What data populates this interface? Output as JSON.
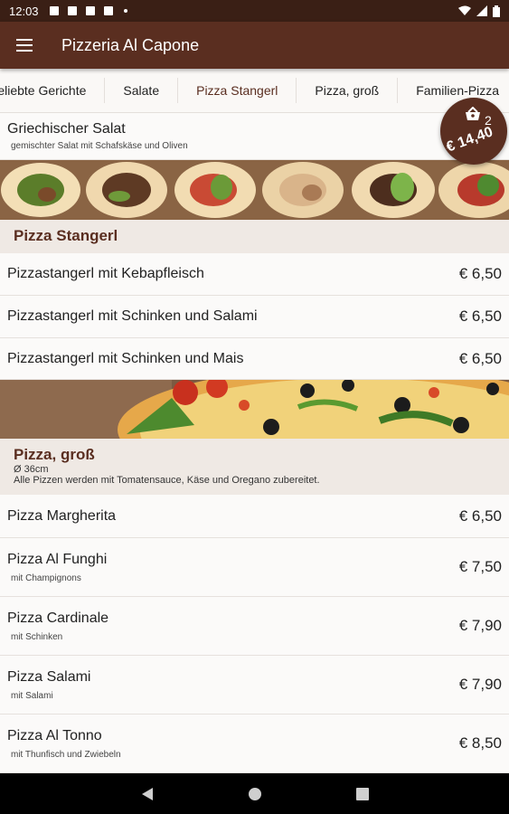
{
  "status": {
    "time": "12:03"
  },
  "appbar": {
    "title": "Pizzeria Al Capone"
  },
  "tabs": [
    "Beliebte Gerichte",
    "Salate",
    "Pizza Stangerl",
    "Pizza, groß",
    "Familien-Pizza"
  ],
  "cart": {
    "count": "2",
    "total": "€ 14,40"
  },
  "top_item": {
    "name": "Griechischer Salat",
    "desc": "gemischter Salat mit Schafskäse und Oliven"
  },
  "sections": [
    {
      "name": "Pizza Stangerl",
      "items": [
        {
          "name": "Pizzastangerl mit Kebapfleisch",
          "price": "€ 6,50"
        },
        {
          "name": "Pizzastangerl mit Schinken und Salami",
          "price": "€ 6,50"
        },
        {
          "name": "Pizzastangerl mit Schinken und Mais",
          "price": "€ 6,50"
        }
      ]
    },
    {
      "name": "Pizza, groß",
      "size": "Ø 36cm",
      "note": "Alle Pizzen werden mit Tomatensauce, Käse und Oregano zubereitet.",
      "items": [
        {
          "name": "Pizza Margherita",
          "desc": "",
          "price": "€ 6,50"
        },
        {
          "name": "Pizza Al Funghi",
          "desc": "mit Champignons",
          "price": "€ 7,50"
        },
        {
          "name": "Pizza Cardinale",
          "desc": "mit Schinken",
          "price": "€ 7,90"
        },
        {
          "name": "Pizza Salami",
          "desc": "mit Salami",
          "price": "€ 7,90"
        },
        {
          "name": "Pizza Al Tonno",
          "desc": "mit Thunfisch und Zwiebeln",
          "price": "€ 8,50"
        }
      ]
    }
  ],
  "colors": {
    "brand": "#5a2e20",
    "statusbar": "#3a1f15",
    "background": "#f4f1ee"
  }
}
